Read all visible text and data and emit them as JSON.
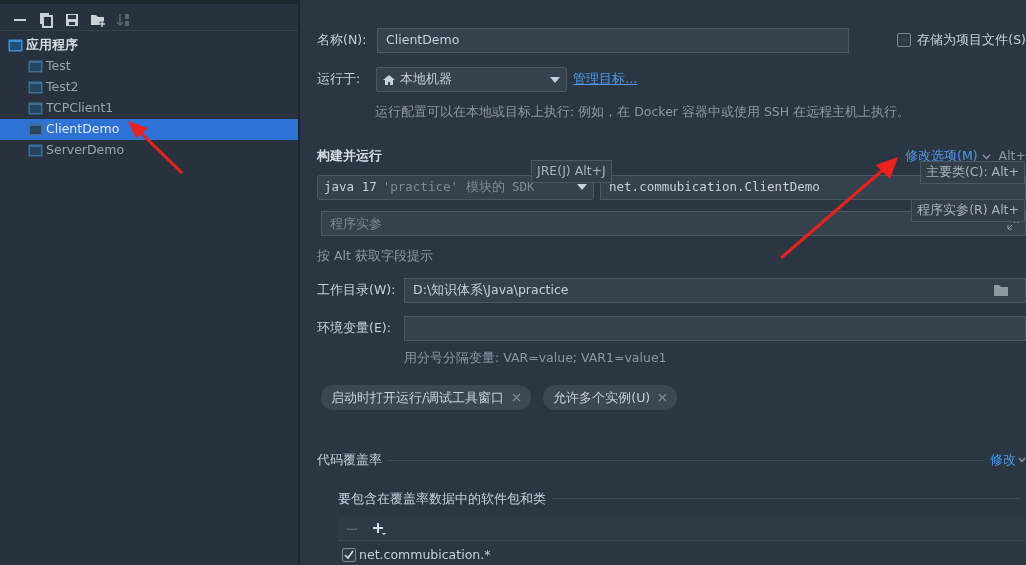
{
  "tree": {
    "label": "应用程序",
    "children": [
      {
        "label": "Test",
        "selected": false
      },
      {
        "label": "Test2",
        "selected": false
      },
      {
        "label": "TCPClient1",
        "selected": false
      },
      {
        "label": "ClientDemo",
        "selected": true
      },
      {
        "label": "ServerDemo",
        "selected": false
      }
    ]
  },
  "name_row": {
    "label": "名称(N):",
    "value": "ClientDemo"
  },
  "store_checkbox": {
    "label": "存储为项目文件(S)",
    "checked": false
  },
  "run_on": {
    "label": "运行于:",
    "value": "本地机器",
    "link": "管理目标...",
    "hint": "运行配置可以在本地或目标上执行: 例如，在 Docker 容器中或使用 SSH 在远程主机上执行。"
  },
  "build_run": {
    "title": "构建并运行",
    "modify_link": "修改选项(M)",
    "shortcut": "Alt+",
    "sdk": {
      "main": "java 17",
      "detail": "'practice' 模块的 SDK"
    },
    "main_class": "net.commubication.ClientDemo",
    "args_placeholder": "程序实参",
    "hint": "按 Alt 获取字段提示",
    "tooltips": [
      "JRE(J) Alt+J",
      "主要类(C): Alt+",
      "程序实参(R) Alt+"
    ]
  },
  "work_dir": {
    "label": "工作目录(W):",
    "value": "D:\\知识体系\\Java\\practice"
  },
  "env": {
    "label": "环境变量(E):",
    "hint": "用分号分隔变量: VAR=value; VAR1=value1"
  },
  "chips": [
    {
      "label": "启动时打开运行/调试工具窗口"
    },
    {
      "label": "允许多个实例(U)"
    }
  ],
  "coverage": {
    "title": "代码覆盖率",
    "link": "修改",
    "subtitle": "要包含在覆盖率数据中的软件包和类",
    "items": [
      {
        "label": "net.commubication.*",
        "checked": true
      }
    ]
  }
}
